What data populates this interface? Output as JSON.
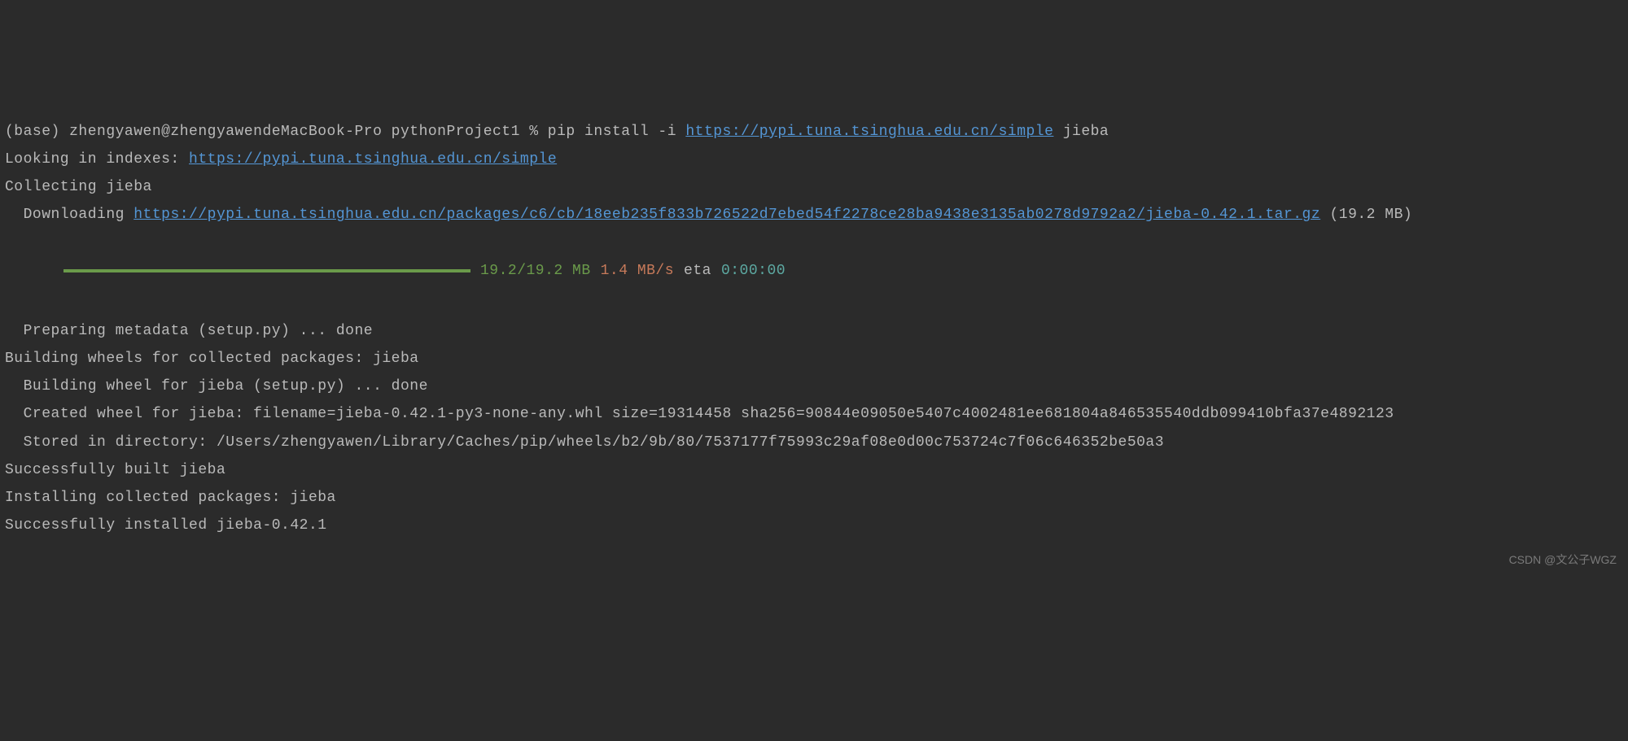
{
  "prompt": {
    "text_before_link": "(base) zhengyawen@zhengyawendeMacBook-Pro pythonProject1 % pip install -i ",
    "index_url": "https://pypi.tuna.tsinghua.edu.cn/simple",
    "text_after_link": " jieba"
  },
  "indexes": {
    "prefix": "Looking in indexes: ",
    "url": "https://pypi.tuna.tsinghua.edu.cn/simple"
  },
  "collecting": "Collecting jieba",
  "downloading": {
    "prefix": "  Downloading ",
    "url_part1": "https://pypi.tuna.tsinghua.edu.cn/packages/c6/cb/18eeb235f833b726522d7ebed54f2278ce28ba9438e3135ab0278d9792a2/jieba-0.42.1.tar.gz",
    "suffix": " (19.2 MB)"
  },
  "progress": {
    "size": "19.2/19.2 MB",
    "speed": "1.4 MB/s",
    "eta_label": "eta",
    "eta_time": "0:00:00"
  },
  "preparing": "  Preparing metadata (setup.py) ... done",
  "building_wheels": "Building wheels for collected packages: jieba",
  "building_wheel": "  Building wheel for jieba (setup.py) ... done",
  "created_wheel": "  Created wheel for jieba: filename=jieba-0.42.1-py3-none-any.whl size=19314458 sha256=90844e09050e5407c4002481ee681804a846535540ddb099410bfa37e4892123",
  "stored": "  Stored in directory: /Users/zhengyawen/Library/Caches/pip/wheels/b2/9b/80/7537177f75993c29af08e0d00c753724c7f06c646352be50a3",
  "built": "Successfully built jieba",
  "installing": "Installing collected packages: jieba",
  "installed": "Successfully installed jieba-0.42.1",
  "watermark": "CSDN @文公子WGZ"
}
